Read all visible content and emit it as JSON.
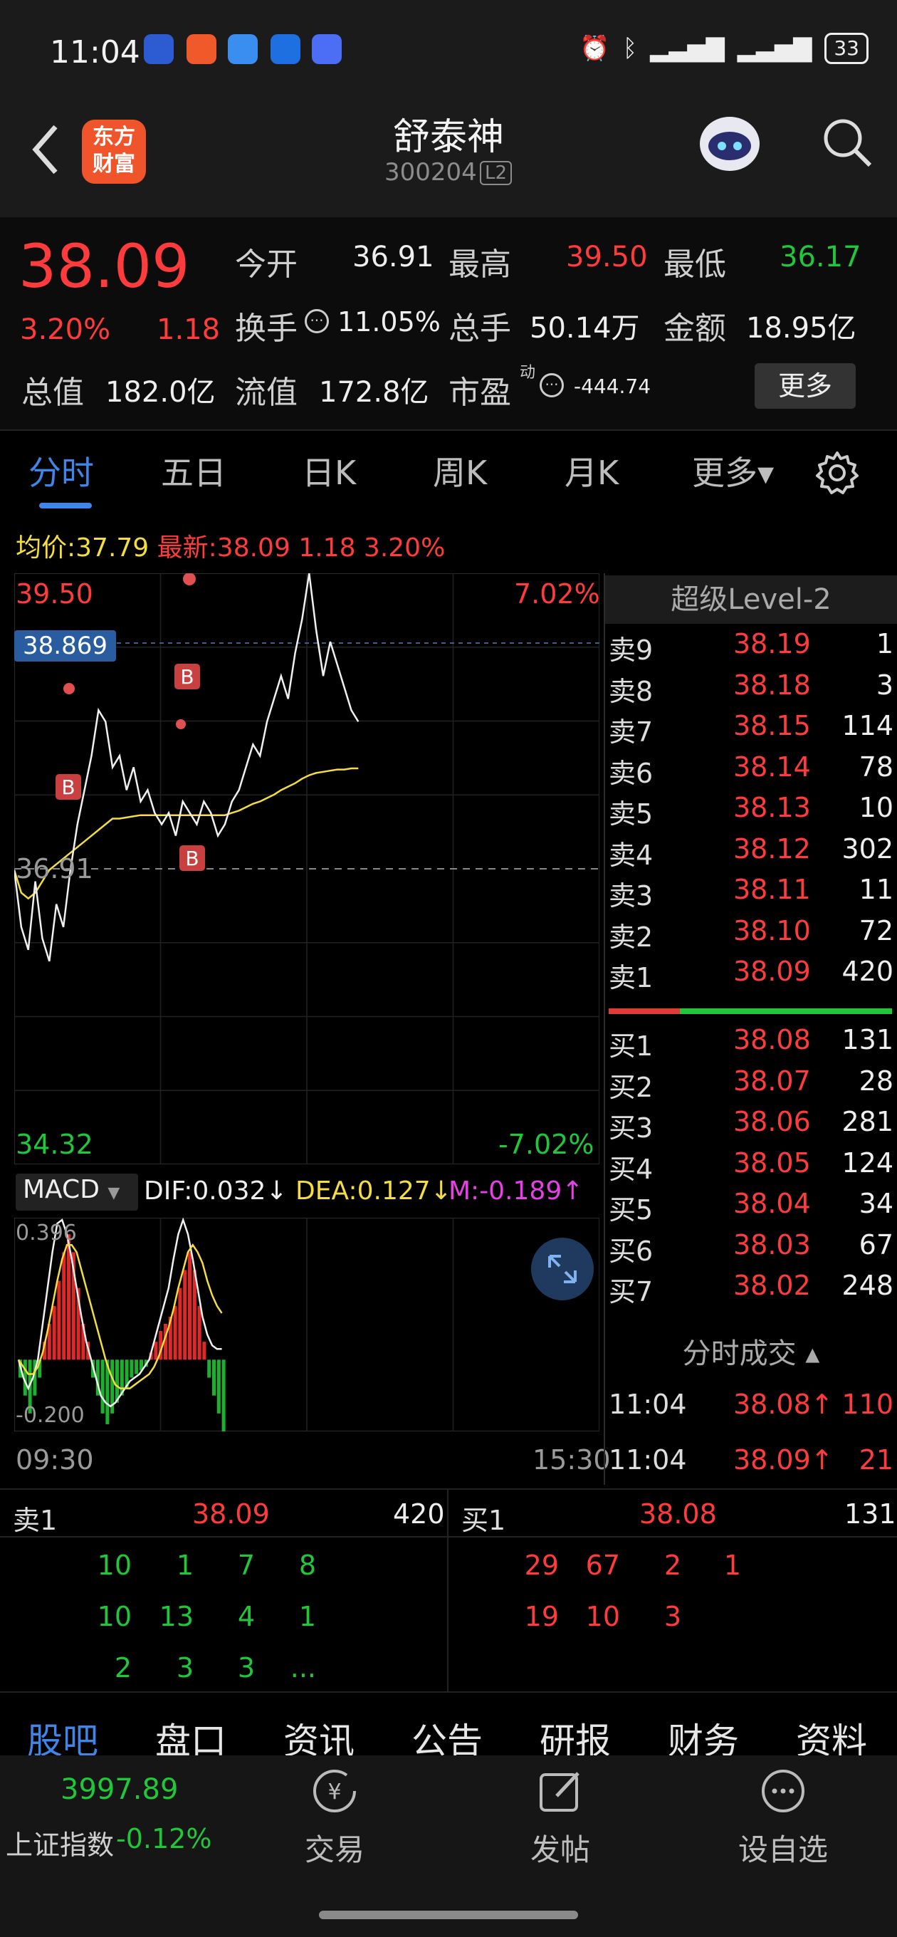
{
  "status_bar": {
    "time": "11:04",
    "battery": "33"
  },
  "header": {
    "stock_name": "舒泰神",
    "stock_code": "300204",
    "level_badge": "L2",
    "logo_text_1": "东方",
    "logo_text_2": "财富"
  },
  "quote": {
    "price": "38.09",
    "change_pct": "3.20%",
    "change": "1.18",
    "open_label": "今开",
    "open": "36.91",
    "high_label": "最高",
    "high": "39.50",
    "low_label": "最低",
    "low": "36.17",
    "turnover_label": "换手",
    "turnover": "11.05%",
    "volume_label": "总手",
    "volume": "50.14万",
    "amount_label": "金额",
    "amount": "18.95亿",
    "mktcap_label": "总值",
    "mktcap": "182.0亿",
    "float_label": "流值",
    "float_cap": "172.8亿",
    "pe_label": "市盈",
    "pe_sup": "动",
    "pe": "-444.74",
    "more_label": "更多"
  },
  "tabs": [
    {
      "label": "分时",
      "active": true
    },
    {
      "label": "五日"
    },
    {
      "label": "日K"
    },
    {
      "label": "周K"
    },
    {
      "label": "月K"
    },
    {
      "label": "更多▾"
    }
  ],
  "avg_line": {
    "avg_label": "均价:",
    "avg": "37.79",
    "last_label": "最新:",
    "last": "38.09",
    "chg": "1.18",
    "pct": "3.20%"
  },
  "chart_data": {
    "type": "line",
    "y_max_label": "39.50",
    "y_max_pct": "7.02%",
    "y_min_label": "34.32",
    "y_min_pct": "-7.02%",
    "ref_label": "36.91",
    "crosshair_label": "38.869",
    "ylim": [
      34.32,
      39.5
    ],
    "price": [
      36.9,
      36.4,
      36.2,
      36.8,
      36.3,
      36.1,
      36.6,
      36.4,
      36.9,
      37.3,
      37.6,
      37.9,
      38.3,
      38.2,
      37.8,
      37.9,
      37.6,
      37.8,
      37.5,
      37.6,
      37.4,
      37.3,
      37.4,
      37.2,
      37.5,
      37.4,
      37.3,
      37.5,
      37.4,
      37.2,
      37.3,
      37.5,
      37.6,
      37.8,
      38.0,
      37.9,
      38.2,
      38.4,
      38.6,
      38.4,
      38.8,
      39.1,
      39.5,
      39.0,
      38.6,
      38.9,
      38.7,
      38.5,
      38.3,
      38.2
    ],
    "avg": [
      36.9,
      36.7,
      36.65,
      36.7,
      36.8,
      36.9,
      36.95,
      37.0,
      37.05,
      37.1,
      37.15,
      37.2,
      37.25,
      37.3,
      37.35,
      37.35,
      37.36,
      37.37,
      37.38,
      37.38,
      37.38,
      37.38,
      37.38,
      37.38,
      37.38,
      37.38,
      37.38,
      37.38,
      37.38,
      37.38,
      37.38,
      37.4,
      37.42,
      37.45,
      37.48,
      37.5,
      37.53,
      37.56,
      37.6,
      37.63,
      37.66,
      37.7,
      37.73,
      37.75,
      37.76,
      37.77,
      37.78,
      37.78,
      37.79,
      37.79
    ],
    "x_start": "09:30",
    "x_end": "15:30",
    "macd": {
      "name": "MACD",
      "dif": "DIF:0.032↓",
      "dea": "DEA:0.127↓",
      "m": "M:-0.189↑",
      "top_label": "0.396",
      "bottom_label": "-0.200",
      "ylim": [
        -0.2,
        0.396
      ],
      "bars": [
        -0.05,
        -0.1,
        -0.15,
        -0.1,
        -0.05,
        0.05,
        0.1,
        0.15,
        0.22,
        0.3,
        0.35,
        0.3,
        0.2,
        0.1,
        0.05,
        -0.05,
        -0.1,
        -0.15,
        -0.18,
        -0.15,
        -0.12,
        -0.1,
        -0.08,
        -0.05,
        -0.04,
        -0.03,
        -0.02,
        0.02,
        0.05,
        0.08,
        0.1,
        0.12,
        0.15,
        0.2,
        0.25,
        0.3,
        0.25,
        0.15,
        0.05,
        -0.05,
        -0.1,
        -0.15,
        -0.2
      ],
      "dif_line": [
        0.0,
        -0.05,
        -0.08,
        -0.05,
        0.0,
        0.1,
        0.2,
        0.3,
        0.38,
        0.39,
        0.35,
        0.28,
        0.2,
        0.12,
        0.05,
        0.0,
        -0.05,
        -0.1,
        -0.12,
        -0.13,
        -0.12,
        -0.1,
        -0.08,
        -0.06,
        -0.05,
        -0.04,
        -0.02,
        0.0,
        0.05,
        0.1,
        0.15,
        0.2,
        0.28,
        0.35,
        0.39,
        0.35,
        0.28,
        0.2,
        0.12,
        0.07,
        0.04,
        0.03,
        0.03
      ],
      "dea_line": [
        0.0,
        -0.02,
        -0.04,
        -0.04,
        -0.02,
        0.02,
        0.08,
        0.15,
        0.22,
        0.28,
        0.32,
        0.32,
        0.3,
        0.25,
        0.2,
        0.15,
        0.1,
        0.05,
        0.0,
        -0.04,
        -0.07,
        -0.08,
        -0.08,
        -0.08,
        -0.07,
        -0.06,
        -0.05,
        -0.04,
        -0.02,
        0.01,
        0.05,
        0.09,
        0.14,
        0.2,
        0.25,
        0.3,
        0.32,
        0.3,
        0.27,
        0.22,
        0.18,
        0.15,
        0.13
      ]
    }
  },
  "level2": {
    "title": "超级Level-2",
    "sell": [
      {
        "label": "卖9",
        "price": "38.19",
        "vol": "1"
      },
      {
        "label": "卖8",
        "price": "38.18",
        "vol": "3"
      },
      {
        "label": "卖7",
        "price": "38.15",
        "vol": "114"
      },
      {
        "label": "卖6",
        "price": "38.14",
        "vol": "78"
      },
      {
        "label": "卖5",
        "price": "38.13",
        "vol": "10"
      },
      {
        "label": "卖4",
        "price": "38.12",
        "vol": "302"
      },
      {
        "label": "卖3",
        "price": "38.11",
        "vol": "11"
      },
      {
        "label": "卖2",
        "price": "38.10",
        "vol": "72"
      },
      {
        "label": "卖1",
        "price": "38.09",
        "vol": "420"
      }
    ],
    "buy": [
      {
        "label": "买1",
        "price": "38.08",
        "vol": "131"
      },
      {
        "label": "买2",
        "price": "38.07",
        "vol": "28"
      },
      {
        "label": "买3",
        "price": "38.06",
        "vol": "281"
      },
      {
        "label": "买4",
        "price": "38.05",
        "vol": "124"
      },
      {
        "label": "买5",
        "price": "38.04",
        "vol": "34"
      },
      {
        "label": "买6",
        "price": "38.03",
        "vol": "67"
      },
      {
        "label": "买7",
        "price": "38.02",
        "vol": "248"
      }
    ],
    "ticks_title": "分时成交 ▴",
    "ticks": [
      {
        "time": "11:04",
        "price": "38.08↑",
        "vol": "110"
      },
      {
        "time": "11:04",
        "price": "38.09↑",
        "vol": "21"
      }
    ]
  },
  "queue": {
    "sell_label": "卖1",
    "sell_price": "38.09",
    "sell_vol": "420",
    "buy_label": "买1",
    "buy_price": "38.08",
    "buy_vol": "131",
    "sell_rows": [
      [
        "10",
        "1",
        "7",
        "8"
      ],
      [
        "10",
        "13",
        "4",
        "1"
      ],
      [
        "2",
        "3",
        "3",
        "..."
      ]
    ],
    "buy_rows": [
      [
        "29",
        "67",
        "2",
        "1"
      ],
      [
        "19",
        "10",
        "3",
        ""
      ]
    ]
  },
  "bottom_tabs": [
    "股吧",
    "盘口",
    "资讯",
    "公告",
    "研报",
    "财务",
    "资料"
  ],
  "footer": {
    "index_value": "3997.89",
    "index_name": "上证指数",
    "index_pct": "-0.12%",
    "trade_label": "交易",
    "post_label": "发帖",
    "watch_label": "设自选"
  }
}
